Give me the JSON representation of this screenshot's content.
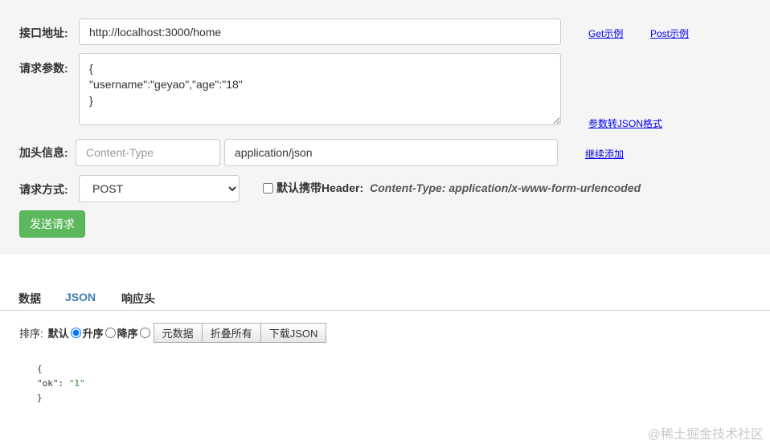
{
  "form": {
    "url_label": "接口地址:",
    "url_value": "http://localhost:3000/home",
    "params_label": "请求参数:",
    "params_value": "{\n\"username\":\"geyao\",\"age\":\"18\"\n}",
    "header_label": "加头信息:",
    "header_key_placeholder": "Content-Type",
    "header_value": "application/json",
    "method_label": "请求方式:",
    "method_selected": "POST",
    "checkbox_label": "默认携带Header:",
    "checkbox_note": "Content-Type: application/x-www-form-urlencoded",
    "send_label": "发送请求"
  },
  "links": {
    "get_example": "Get示例",
    "post_example": "Post示例",
    "to_json": "参数转JSON格式",
    "add_more": "继续添加"
  },
  "tabs": [
    {
      "label": "数据"
    },
    {
      "label": "JSON"
    },
    {
      "label": "响应头"
    }
  ],
  "toolbar": {
    "sort_label": "排序:",
    "opt_default": "默认",
    "opt_asc": "升序",
    "opt_desc": "降序",
    "btn_raw": "元数据",
    "btn_collapse": "折叠所有",
    "btn_download": "下载JSON"
  },
  "json_output": {
    "open": "{",
    "key": "\"ok\"",
    "colon": ":",
    "value": "\"1\"",
    "close": "}"
  },
  "watermark": "@稀土掘金技术社区"
}
